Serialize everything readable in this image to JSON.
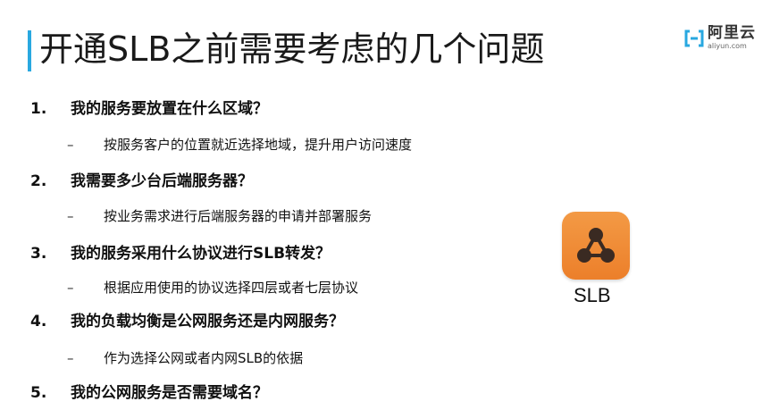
{
  "slide": {
    "title": "开通SLB之前需要考虑的几个问题",
    "logo": {
      "cn": "阿里云",
      "en": "aliyun.com"
    },
    "questions": [
      {
        "num": "1.",
        "text": "我的服务要放置在什么区域？",
        "answer": "按服务客户的位置就近选择地域，提升用户访问速度"
      },
      {
        "num": "2.",
        "text": "我需要多少台后端服务器？",
        "answer": "按业务需求进行后端服务器的申请并部署服务"
      },
      {
        "num": "3.",
        "text": "我的服务采用什么协议进行SLB转发？",
        "answer": "根据应用使用的协议选择四层或者七层协议"
      },
      {
        "num": "4.",
        "text": "我的负载均衡是公网服务还是内网服务？",
        "answer": "作为选择公网或者内网SLB的依据"
      },
      {
        "num": "5.",
        "text": "我的公网服务是否需要域名？"
      }
    ],
    "dash": "–",
    "icon_label": "SLB",
    "colors": {
      "accent": "#29a8e0",
      "icon": "#ec7f2a"
    }
  }
}
